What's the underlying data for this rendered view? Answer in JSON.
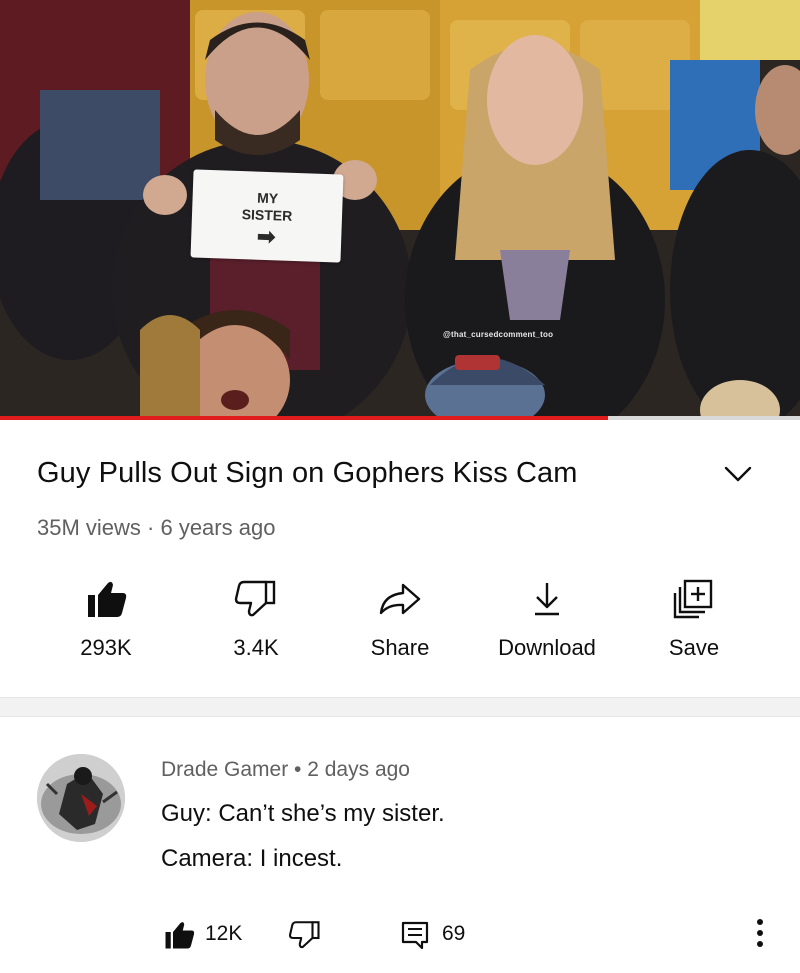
{
  "video": {
    "sign_line1": "MY",
    "sign_line2": "SISTER",
    "sign_arrow": "➡",
    "watermark": "@that_cursedcomment_too",
    "progress": 0.76
  },
  "title": "Guy Pulls Out Sign on Gophers Kiss Cam",
  "meta": "35M views · 6 years ago",
  "actions": [
    {
      "icon": "thumbs-up-filled-icon",
      "label": "293K"
    },
    {
      "icon": "thumbs-down-icon",
      "label": "3.4K"
    },
    {
      "icon": "share-icon",
      "label": "Share"
    },
    {
      "icon": "download-icon",
      "label": "Download"
    },
    {
      "icon": "save-playlist-icon",
      "label": "Save"
    }
  ],
  "comment": {
    "author_line": "Drade Gamer • 2 days ago",
    "line1": "Guy: Can’t she’s my sister.",
    "line2": "Camera: I incest.",
    "likes": "12K",
    "replies": "69"
  },
  "colors": {
    "progress": "#e01b1b",
    "text_primary": "#0f0f0f",
    "text_secondary": "#606060"
  }
}
